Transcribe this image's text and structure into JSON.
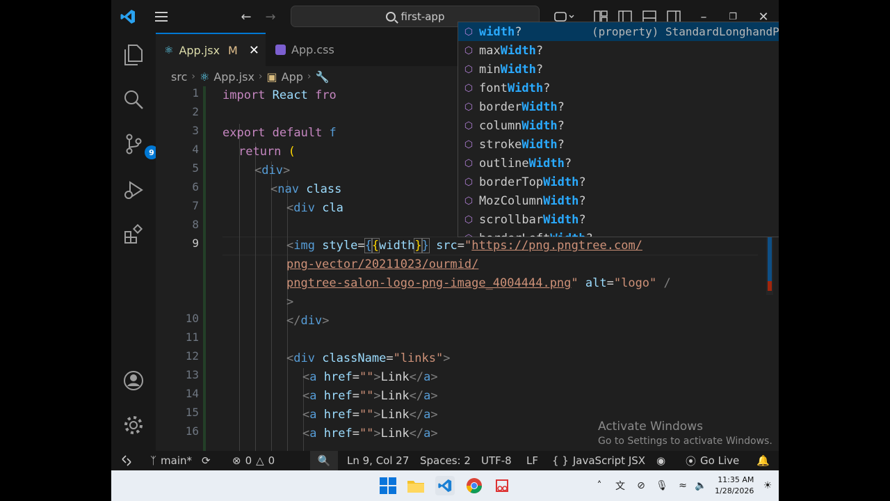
{
  "window": {
    "search_text": "first-app"
  },
  "activity": {
    "badge_count": "9"
  },
  "tabs": [
    {
      "label": "App.jsx",
      "modified": "M"
    },
    {
      "label": "App.css"
    }
  ],
  "breadcrumb": {
    "folder": "src",
    "file": "App.jsx",
    "symbol": "App"
  },
  "editor": {
    "line_numbers": [
      "1",
      "2",
      "3",
      "4",
      "5",
      "6",
      "7",
      "8",
      "9",
      "10",
      "11",
      "12",
      "13",
      "14",
      "15",
      "16"
    ],
    "lines": {
      "l1a": "import",
      "l1b": " React ",
      "l1c": "fro",
      "l3a": "export",
      "l3b": " default ",
      "l3c": "f",
      "l4a": "return",
      "l4b": " (",
      "l5": "div",
      "l6a": "nav",
      "l6b": " class",
      "l7a": "div",
      "l7b": " cla",
      "l9_tag": "img",
      "l9_attr": " style",
      "l9_eq": "=",
      "l9_open": "{{",
      "l9_var": "width",
      "l9_close": "}}",
      "l9_src": " src",
      "l9_url1": "https://png.pngtree.com/",
      "l9_url2": "png-vector/20211023/ourmid/",
      "l9_url3": "pngtree-salon-logo-png-image_4004444.png",
      "l9_alt": " alt",
      "l9_altval": "\"logo\"",
      "l9_end": " /",
      "l9_gt": ">",
      "l10": "div",
      "l12_tag": "div",
      "l12_attr": " className",
      "l12_val": "\"links\"",
      "a_tag": "a",
      "a_attr": " href",
      "a_val": "\"\"",
      "a_text": "Link"
    }
  },
  "suggest": {
    "detail": "(property) StandardLonghandProperties…",
    "items": [
      {
        "pre": "",
        "hl": "width",
        "post": "?"
      },
      {
        "pre": "max",
        "hl": "Width",
        "post": "?"
      },
      {
        "pre": "min",
        "hl": "Width",
        "post": "?"
      },
      {
        "pre": "font",
        "hl": "Width",
        "post": "?"
      },
      {
        "pre": "border",
        "hl": "Width",
        "post": "?"
      },
      {
        "pre": "column",
        "hl": "Width",
        "post": "?"
      },
      {
        "pre": "stroke",
        "hl": "Width",
        "post": "?"
      },
      {
        "pre": "outline",
        "hl": "Width",
        "post": "?"
      },
      {
        "pre": "borderTop",
        "hl": "Width",
        "post": "?"
      },
      {
        "pre": "MozColumn",
        "hl": "Width",
        "post": "?"
      },
      {
        "pre": "scrollbar",
        "hl": "Width",
        "post": "?"
      },
      {
        "pre": "borderLeft",
        "hl": "Width",
        "post": "?"
      }
    ]
  },
  "watermark": {
    "title": "Activate Windows",
    "subtitle": "Go to Settings to activate Windows."
  },
  "status": {
    "branch": "main*",
    "errors": "0",
    "warnings": "0",
    "position": "Ln 9, Col 27",
    "spaces": "Spaces: 2",
    "encoding": "UTF-8",
    "eol": "LF",
    "language": "JavaScript JSX",
    "golive": "Go Live"
  },
  "taskbar": {
    "time": "11:35 AM",
    "date": "1/28/2026"
  },
  "colors": {
    "accent": "#0078d4",
    "background": "#1f1f1f"
  }
}
